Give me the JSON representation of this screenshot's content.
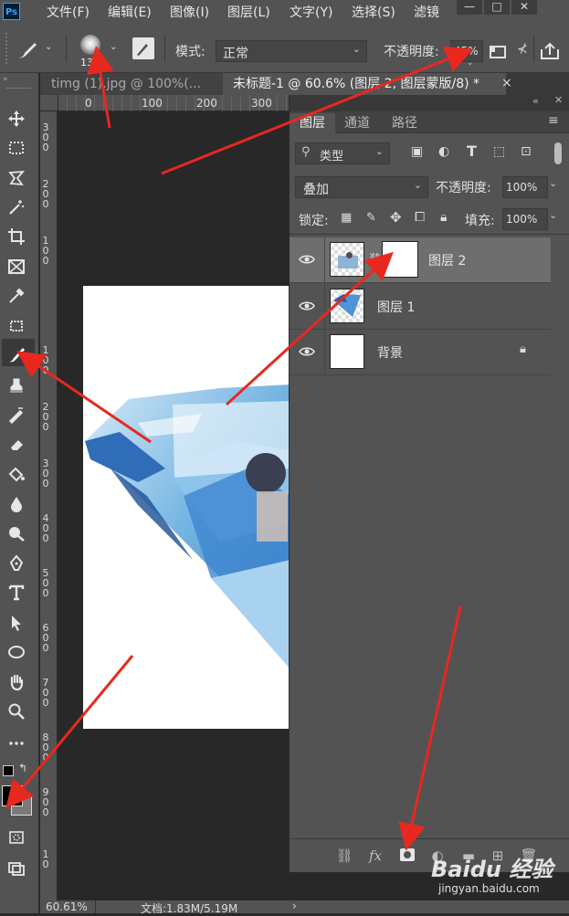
{
  "app": {
    "logo_text": "Ps",
    "menu": [
      "文件(F)",
      "编辑(E)",
      "图像(I)",
      "图层(L)",
      "文字(Y)",
      "选择(S)",
      "滤镜"
    ],
    "window_buttons": [
      "—",
      "□",
      "✕"
    ]
  },
  "options": {
    "brush_size": "136",
    "mode_label": "模式:",
    "mode_value": "正常",
    "opacity_label": "不透明度:",
    "opacity_value": "45%"
  },
  "tabs": [
    {
      "label": "timg (1).jpg @ 100%(...",
      "close": "×"
    },
    {
      "label": "未标题-1 @ 60.6% (图层 2, 图层蒙版/8) *",
      "close": "×"
    }
  ],
  "ruler": {
    "h_ticks": [
      "0",
      "100",
      "200",
      "300"
    ],
    "v_ticks": [
      "3 0 0",
      "2 0 0",
      "1 0 0",
      "1 0 0",
      "2 0 0",
      "3 0 0",
      "4 0 0",
      "5 0 0",
      "6 0 0",
      "7 0 0",
      "8 0 0",
      "9 0 0",
      "1 0"
    ]
  },
  "status": {
    "zoom": "60.61%",
    "doc_info": "文档:1.83M/5.19M",
    "arrow": "›"
  },
  "layers_panel": {
    "tabs": [
      "图层",
      "通道",
      "路径"
    ],
    "filter_label": "类型",
    "blend_mode": "叠加",
    "opacity_label": "不透明度:",
    "opacity_value": "100%",
    "lock_label": "锁定:",
    "fill_label": "填充:",
    "fill_value": "100%",
    "layers": [
      {
        "name": "图层 2",
        "selected": true
      },
      {
        "name": "图层 1",
        "selected": false
      },
      {
        "name": "背景",
        "selected": false
      }
    ]
  },
  "watermark": {
    "brand": "Baidu 经验",
    "url": "jingyan.baidu.com"
  },
  "colors": {
    "ui_dark": "#535353",
    "canvas_bg": "#282828",
    "annotation_arrow": "#e8281e",
    "accent": "#31a8ff"
  }
}
